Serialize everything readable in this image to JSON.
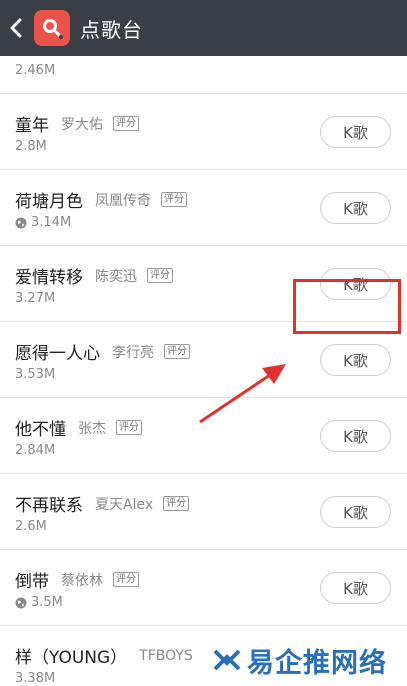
{
  "header": {
    "title": "点歌台"
  },
  "songs": [
    {
      "title": "",
      "artist": "",
      "size": "2.46M",
      "button": "K歌"
    },
    {
      "title": "童年",
      "artist": "罗大佑",
      "score_badge": "评分",
      "size": "2.8M",
      "button": "K歌"
    },
    {
      "title": "荷塘月色",
      "artist": "凤凰传奇",
      "score_badge": "评分",
      "size": "3.14M",
      "button": "K歌",
      "globe": true
    },
    {
      "title": "爱情转移",
      "artist": "陈奕迅",
      "score_badge": "评分",
      "size": "3.27M",
      "button": "K歌"
    },
    {
      "title": "愿得一人心",
      "artist": "李行亮",
      "score_badge": "评分",
      "size": "3.53M",
      "button": "K歌"
    },
    {
      "title": "他不懂",
      "artist": "张杰",
      "score_badge": "评分",
      "size": "2.84M",
      "button": "K歌"
    },
    {
      "title": "不再联系",
      "artist": "夏天Alex",
      "score_badge": "评分",
      "size": "2.6M",
      "button": "K歌"
    },
    {
      "title": "倒带",
      "artist": "蔡依林",
      "score_badge": "评分",
      "size": "3.5M",
      "button": "K歌",
      "globe": true
    },
    {
      "title": "样（YOUNG）",
      "artist": "TFBOYS",
      "size": "3.38M"
    }
  ],
  "watermark": {
    "text": "易企推网络"
  },
  "colors": {
    "header_bg": "#3a3f45",
    "accent_red": "#e0322c",
    "logo_bg": "#e9534a"
  }
}
